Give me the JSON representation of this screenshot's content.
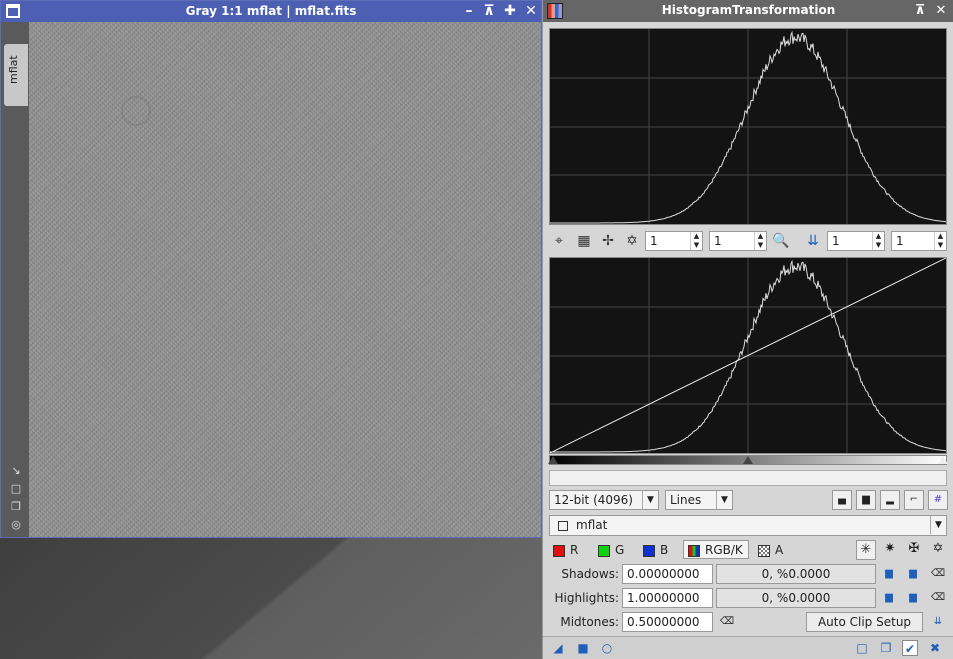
{
  "image_window": {
    "title": "Gray 1:1 mflat | mflat.fits",
    "tab_label": "mflat",
    "controls": [
      "minimize-icon",
      "shade-icon",
      "maximize-icon",
      "close-icon"
    ]
  },
  "tool_window": {
    "title": "HistogramTransformation",
    "controls": [
      "shade-icon",
      "close-icon"
    ]
  },
  "zoom_row": {
    "h_zoom_1": "1",
    "v_zoom_1": "1",
    "h_zoom_2": "1",
    "v_zoom_2": "1"
  },
  "display": {
    "resolution": "12-bit (4096)",
    "mode": "Lines"
  },
  "view_selector": {
    "selected": "mflat"
  },
  "channels": {
    "r_label": "R",
    "g_label": "G",
    "b_label": "B",
    "rgbk_label": "RGB/K",
    "a_label": "A",
    "r_color": "#e01010",
    "g_color": "#10d010",
    "b_color": "#1030d0"
  },
  "params": {
    "shadows_label": "Shadows:",
    "shadows_value": "0.00000000",
    "shadows_clip": "0, %0.0000",
    "highlights_label": "Highlights:",
    "highlights_value": "1.00000000",
    "highlights_clip": "0, %0.0000",
    "midtones_label": "Midtones:",
    "midtones_value": "0.50000000",
    "auto_clip_label": "Auto Clip Setup"
  }
}
